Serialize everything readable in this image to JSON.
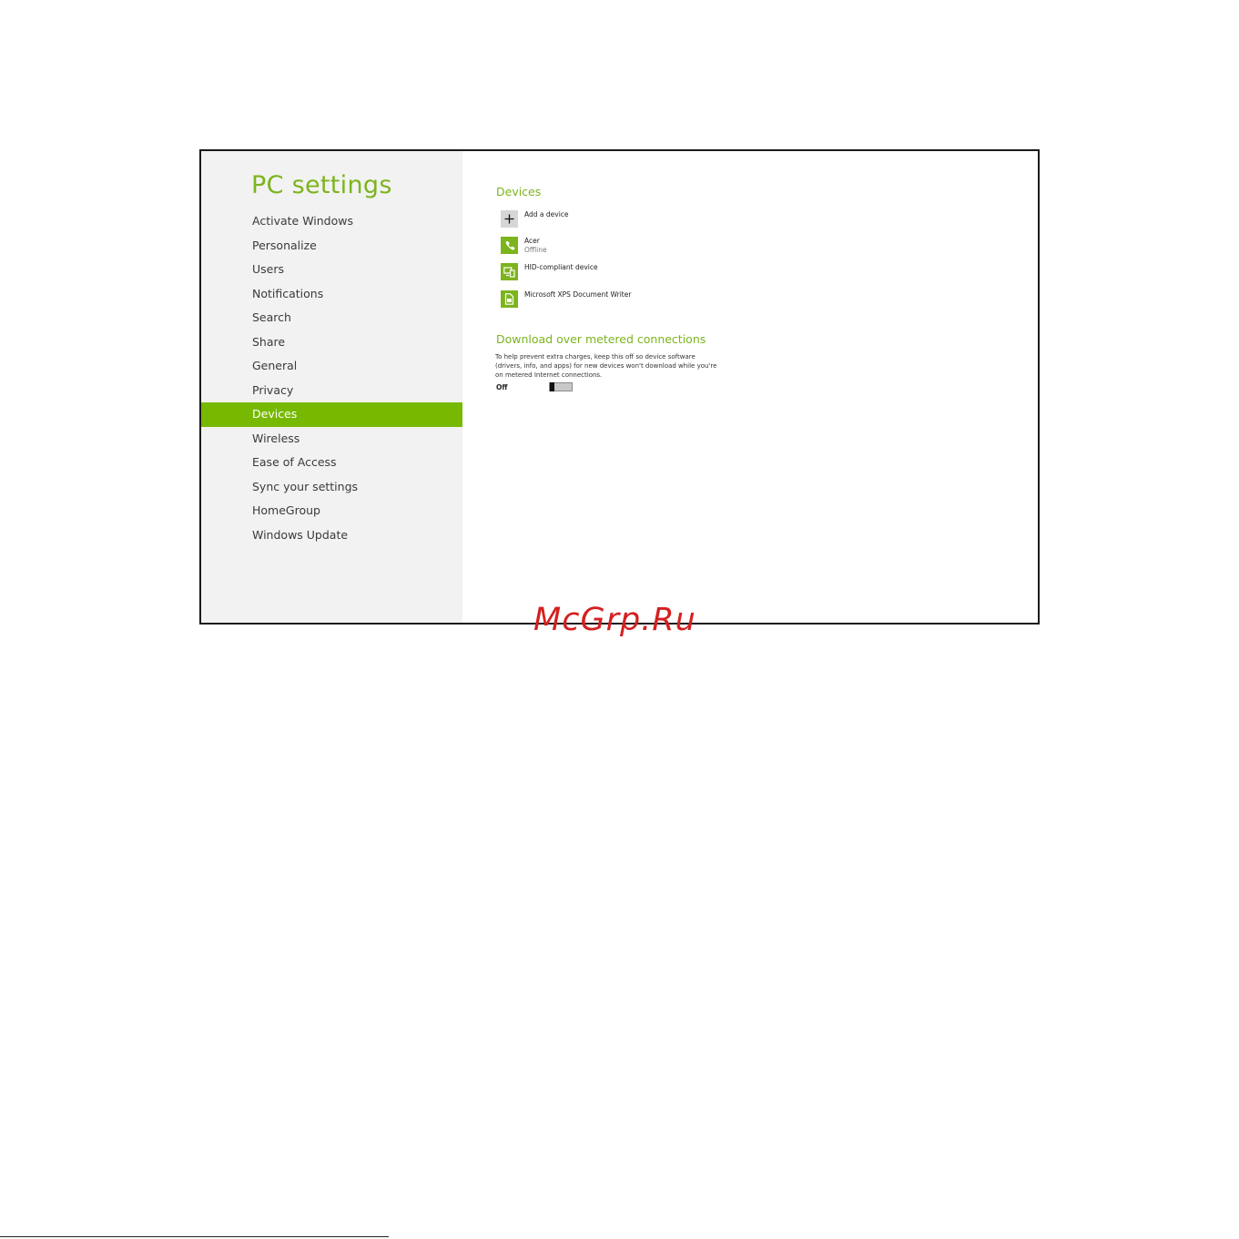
{
  "sidebar": {
    "title": "PC settings",
    "items": [
      {
        "label": "Activate Windows"
      },
      {
        "label": "Personalize"
      },
      {
        "label": "Users"
      },
      {
        "label": "Notifications"
      },
      {
        "label": "Search"
      },
      {
        "label": "Share"
      },
      {
        "label": "General"
      },
      {
        "label": "Privacy"
      },
      {
        "label": "Devices",
        "active": true
      },
      {
        "label": "Wireless"
      },
      {
        "label": "Ease of Access"
      },
      {
        "label": "Sync your settings"
      },
      {
        "label": "HomeGroup"
      },
      {
        "label": "Windows Update"
      }
    ]
  },
  "main": {
    "devices_title": "Devices",
    "devices": [
      {
        "name": "Add a device",
        "icon": "plus-icon"
      },
      {
        "name": "Acer",
        "status": "Offline",
        "icon": "phone-icon"
      },
      {
        "name": "HID-compliant device",
        "icon": "devices-icon"
      },
      {
        "name": "Microsoft XPS Document Writer",
        "icon": "printer-icon"
      }
    ],
    "metered_title": "Download over metered connections",
    "metered_desc": "To help prevent extra charges, keep this off so device software (drivers, info, and apps) for new devices won't download while you're on metered Internet connections.",
    "toggle_label": "Off",
    "toggle_on": false
  },
  "watermark": "McGrp.Ru",
  "colors": {
    "accent": "#76b900",
    "title": "#7cb41d",
    "sidebar_bg": "#f2f2f2",
    "watermark": "#d42020"
  }
}
